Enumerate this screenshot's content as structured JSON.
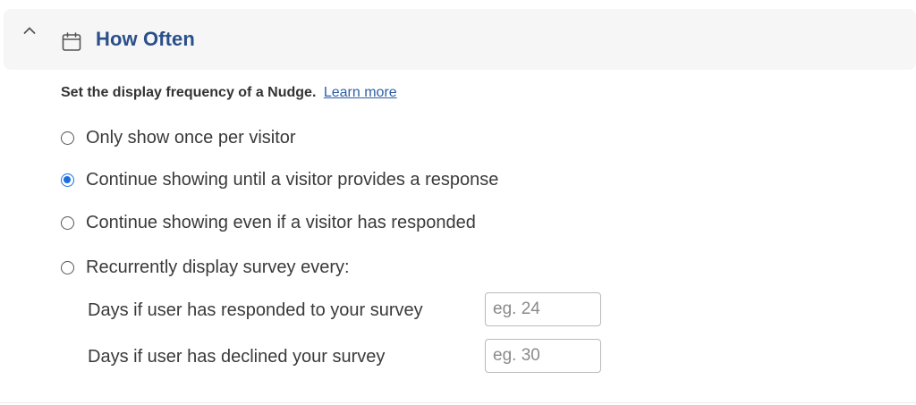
{
  "section": {
    "title": "How Often",
    "collapse_icon": "chevron-up-icon",
    "title_icon": "calendar-icon",
    "accent_color": "#2a4f8a"
  },
  "description": {
    "text": "Set the display frequency of a Nudge.",
    "link_label": "Learn more"
  },
  "options": [
    {
      "label": "Only show once per visitor",
      "selected": false
    },
    {
      "label": "Continue showing until a visitor provides a response",
      "selected": true
    },
    {
      "label": "Continue showing even if a visitor has responded",
      "selected": false
    },
    {
      "label": "Recurrently display survey every:",
      "selected": false
    }
  ],
  "recurrence": {
    "responded": {
      "label": "Days if user has responded to your survey",
      "value": "",
      "placeholder": "eg. 24"
    },
    "declined": {
      "label": "Days if user has declined your survey",
      "value": "",
      "placeholder": "eg. 30"
    }
  },
  "colors": {
    "radio_selected": "#1a6fe0",
    "link": "#2f5ea8",
    "header_bg": "#f6f6f7"
  }
}
